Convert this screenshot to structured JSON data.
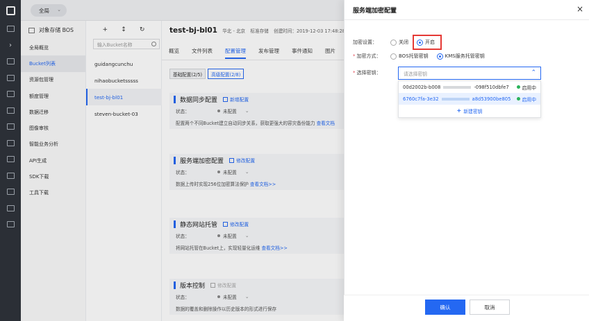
{
  "topbar": {
    "region": "全局"
  },
  "sidenav": {
    "title": "对象存储 BOS",
    "items": [
      "全局概览",
      "Bucket列表",
      "资源包管理",
      "额度管理",
      "数据迁移",
      "图像审核",
      "智能业务分析",
      "API生成",
      "SDK下载",
      "工具下载"
    ]
  },
  "buckets": {
    "tools": [
      "+",
      "↕",
      "↻"
    ],
    "search_placeholder": "输入Bucket名称",
    "items": [
      "guidangcunchu",
      "nihaobucketsssss",
      "test-bj-bl01",
      "steven-bucket-03"
    ]
  },
  "main": {
    "name": "test-bj-bl01",
    "region": "华北 - 北京",
    "storage": "标准存储",
    "created_prefix": "创建时间：",
    "created": "2019-12-03 17:48:28",
    "tabs": [
      "概览",
      "文件列表",
      "配置管理",
      "发布管理",
      "事件通知",
      "图片"
    ],
    "subtabs": [
      "基础配置(2/5)",
      "高级配置(2/8)"
    ],
    "status_label": "状态：",
    "status_value": "未配置",
    "cards": [
      {
        "title": "数据同步配置",
        "link": "新增配置",
        "desc": "配置两个不同Bucket建立自动同步关系，获取更强大的容灾备份能力",
        "desc_link": "查看文档"
      },
      {
        "title": "服务端加密配置",
        "link": "修改配置",
        "desc": "数据上传时实现256位加密算法保护",
        "desc_link": "查看文档>>"
      },
      {
        "title": "静态网站托管",
        "link": "修改配置",
        "desc": "将网站托管在Bucket上，实现轻量化运维",
        "desc_link": "查看文档>>"
      },
      {
        "title": "版本控制",
        "link": "修改配置",
        "desc": "数据的覆盖和删除操作以历史版本的形式进行保存",
        "desc_link": ""
      }
    ]
  },
  "panel": {
    "title": "服务端加密配置",
    "close": "×",
    "encrypt_label": "加密设置：",
    "encrypt_off": "关闭",
    "encrypt_on": "开启",
    "method_label": "加密方式：",
    "method_bos": "BOS托管密钥",
    "method_kms": "KMS服务托管密钥",
    "key_label": "选择密钥：",
    "key_placeholder": "请选择密钥",
    "keys": [
      {
        "prefix": "00d2002b-b008",
        "suffix": "-098f510dbfe7",
        "state": "启用中"
      },
      {
        "prefix": "6760c7fa-3e32",
        "suffix": "a8d53900be805",
        "state": "启用中"
      }
    ],
    "new_key": "新建密钥",
    "ok": "确认",
    "cancel": "取消"
  },
  "colors": {
    "accent": "#2468f2",
    "highlight": "#e53935",
    "enabled": "#29b35a"
  }
}
